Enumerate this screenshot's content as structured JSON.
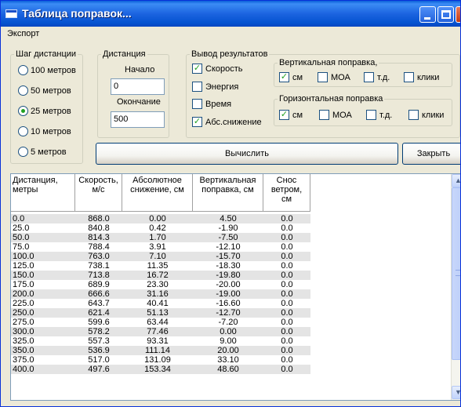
{
  "window": {
    "title": "Таблица поправок...",
    "accent": "#0a5fd8",
    "controls": [
      "minimize-icon",
      "maximize-icon",
      "close-icon"
    ]
  },
  "menu": {
    "export": "Экспорт"
  },
  "step_group": {
    "legend": "Шаг дистанции",
    "options": [
      "100 метров",
      "50 метров",
      "25 метров",
      "10 метров",
      "5 метров"
    ],
    "selected": "25 метров"
  },
  "distance_group": {
    "legend": "Дистанция",
    "start_label": "Начало",
    "start_value": "0",
    "end_label": "Окончание",
    "end_value": "500"
  },
  "output_group": {
    "legend": "Вывод результатов",
    "options": [
      {
        "label": "Скорость",
        "checked": true
      },
      {
        "label": "Энергия",
        "checked": false
      },
      {
        "label": "Время",
        "checked": false
      },
      {
        "label": "Абс.снижение",
        "checked": true
      }
    ]
  },
  "vertical_group": {
    "legend": "Вертикальная поправка,",
    "options": [
      {
        "label": "см",
        "checked": true
      },
      {
        "label": "МОА",
        "checked": false
      },
      {
        "label": "т.д.",
        "checked": false
      },
      {
        "label": "клики",
        "checked": false
      }
    ]
  },
  "horizontal_group": {
    "legend": "Горизонтальная поправка",
    "options": [
      {
        "label": "см",
        "checked": true
      },
      {
        "label": "МОА",
        "checked": false
      },
      {
        "label": "т.д.",
        "checked": false
      },
      {
        "label": "клики",
        "checked": false
      }
    ]
  },
  "buttons": {
    "compute": "Вычислить",
    "close": "Закрыть"
  },
  "table": {
    "headers": [
      "Дистанция,\nметры",
      "Скорость,\nм/с",
      "Абсолютное\nснижение, см",
      "Вертикальная\nпоправка, см",
      "Снос\nветром,\nсм"
    ],
    "rows": [
      [
        "0.0",
        "868.0",
        "0.00",
        "4.50",
        "0.0"
      ],
      [
        "25.0",
        "840.8",
        "0.42",
        "-1.90",
        "0.0"
      ],
      [
        "50.0",
        "814.3",
        "1.70",
        "-7.50",
        "0.0"
      ],
      [
        "75.0",
        "788.4",
        "3.91",
        "-12.10",
        "0.0"
      ],
      [
        "100.0",
        "763.0",
        "7.10",
        "-15.70",
        "0.0"
      ],
      [
        "125.0",
        "738.1",
        "11.35",
        "-18.30",
        "0.0"
      ],
      [
        "150.0",
        "713.8",
        "16.72",
        "-19.80",
        "0.0"
      ],
      [
        "175.0",
        "689.9",
        "23.30",
        "-20.00",
        "0.0"
      ],
      [
        "200.0",
        "666.6",
        "31.16",
        "-19.00",
        "0.0"
      ],
      [
        "225.0",
        "643.7",
        "40.41",
        "-16.60",
        "0.0"
      ],
      [
        "250.0",
        "621.4",
        "51.13",
        "-12.70",
        "0.0"
      ],
      [
        "275.0",
        "599.6",
        "63.44",
        "-7.20",
        "0.0"
      ],
      [
        "300.0",
        "578.2",
        "77.46",
        "0.00",
        "0.0"
      ],
      [
        "325.0",
        "557.3",
        "93.31",
        "9.00",
        "0.0"
      ],
      [
        "350.0",
        "536.9",
        "111.14",
        "20.00",
        "0.0"
      ],
      [
        "375.0",
        "517.0",
        "131.09",
        "33.10",
        "0.0"
      ],
      [
        "400.0",
        "497.6",
        "153.34",
        "48.60",
        "0.0"
      ]
    ]
  }
}
